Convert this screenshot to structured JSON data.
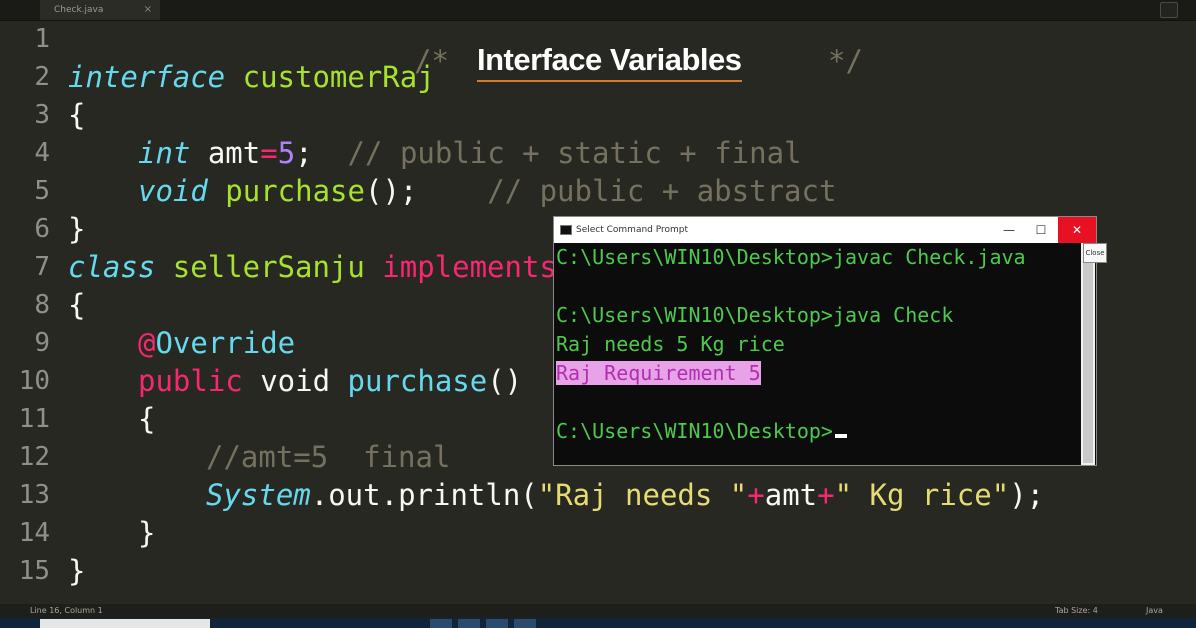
{
  "tab": {
    "filename": "Check.java",
    "close_glyph": "×"
  },
  "heading": {
    "comment_open": "/*",
    "title": "Interface Variables",
    "comment_close": "*/"
  },
  "code": {
    "line_numbers": [
      "1",
      "2",
      "3",
      "4",
      "5",
      "6",
      "7",
      "8",
      "9",
      "10",
      "11",
      "12",
      "13",
      "14",
      "15"
    ],
    "l2_kw": "interface",
    "l2_name": "customerRaj",
    "l3": "{",
    "l4_type": "int",
    "l4_var": " amt",
    "l4_op": "=",
    "l4_num": "5",
    "l4_semi": ";",
    "l4_cmt": "  // public + static + final",
    "l5_type": "void",
    "l5_fn": " purchase",
    "l5_rest": "();",
    "l5_cmt": "    // public + abstract",
    "l6": "}",
    "l7_kw": "class",
    "l7_name": " sellerSanju",
    "l7_impl": " implements",
    "l8": "{",
    "l9_at": "@",
    "l9_ann": "Override",
    "l10_pub": "public",
    "l10_void": " void",
    "l10_fn": " purchase",
    "l10_rest": "()",
    "l11": "{",
    "l12_cmt": "//amt=5  final",
    "l13_sys": "System",
    "l13_mid": ".out.println(",
    "l13_s1": "\"Raj needs \"",
    "l13_op1": "+",
    "l13_var": "amt",
    "l13_op2": "+",
    "l13_s2": "\" Kg rice\"",
    "l13_end": ");",
    "l14": "}",
    "l15": "}"
  },
  "cmd": {
    "title": "Select Command Prompt",
    "minimize": "—",
    "maximize": "☐",
    "close": "✕",
    "tooltip": "Close",
    "lines": [
      "C:\\Users\\WIN10\\Desktop>javac Check.java",
      "",
      "C:\\Users\\WIN10\\Desktop>java Check",
      "Raj needs 5 Kg rice",
      "Raj Requirement 5",
      "",
      "C:\\Users\\WIN10\\Desktop>"
    ]
  },
  "status": {
    "position": "Line 16, Column 1",
    "tab_size": "Tab Size: 4",
    "syntax": "Java"
  },
  "colors": {
    "editor_bg": "#272822",
    "keyword": "#66d9ef",
    "pink": "#f92672",
    "green": "#a6e22e",
    "string": "#e6db74",
    "comment": "#75715e",
    "number": "#ae81ff",
    "cmd_text": "#4ec94e",
    "cmd_highlight": "#e8a3e8"
  }
}
